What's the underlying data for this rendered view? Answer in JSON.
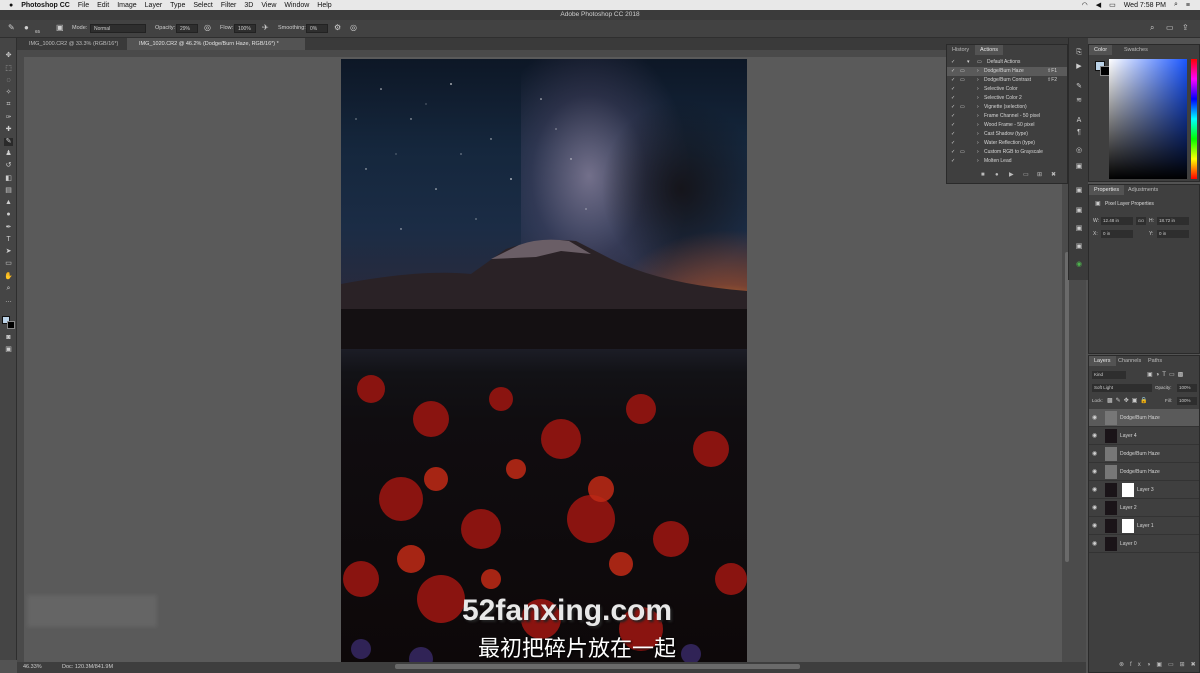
{
  "menubar": {
    "app": "Photoshop CC",
    "items": [
      "File",
      "Edit",
      "Image",
      "Layer",
      "Type",
      "Select",
      "Filter",
      "3D",
      "View",
      "Window",
      "Help"
    ],
    "clock": "Wed 7:58 PM"
  },
  "window_title": "Adobe Photoshop CC 2018",
  "options": {
    "brush_size": "65",
    "mode_label": "Mode:",
    "mode_value": "Normal",
    "opacity_label": "Opacity:",
    "opacity_value": "29%",
    "flow_label": "Flow:",
    "flow_value": "100%",
    "smoothing_label": "Smoothing:",
    "smoothing_value": "0%"
  },
  "tabs": [
    {
      "label": "IMG_1000.CR2 @ 33.3% (RGB/16*)"
    },
    {
      "label": "IMG_1020.CR2 @ 46.2% (Dodge/Burn Haze, RGB/16*) *"
    }
  ],
  "status": {
    "zoom": "46.33%",
    "doc": "Doc: 120.3M/841.9M"
  },
  "actions_panel": {
    "tabs": [
      "History",
      "Actions"
    ],
    "set_name": "Default Actions",
    "items": [
      {
        "name": "Dodge/Burn Haze",
        "key": "⇧F1"
      },
      {
        "name": "Dodge/Burn Contrast",
        "key": "⇧F2"
      },
      {
        "name": "Selective Color",
        "key": ""
      },
      {
        "name": "Selective Color 2",
        "key": ""
      },
      {
        "name": "Vignette (selection)",
        "key": ""
      },
      {
        "name": "Frame Channel - 50 pixel",
        "key": ""
      },
      {
        "name": "Wood Frame - 50 pixel",
        "key": ""
      },
      {
        "name": "Cast Shadow (type)",
        "key": ""
      },
      {
        "name": "Water Reflection (type)",
        "key": ""
      },
      {
        "name": "Custom RGB to Grayscale",
        "key": ""
      },
      {
        "name": "Molten Lead",
        "key": ""
      }
    ]
  },
  "color_panel": {
    "tabs": [
      "Color",
      "Swatches"
    ]
  },
  "properties_panel": {
    "tabs": [
      "Properties",
      "Adjustments"
    ],
    "heading": "Pixel Layer Properties",
    "w_label": "W:",
    "w_value": "12.48 in",
    "h_label": "H:",
    "h_value": "18.72 in",
    "link_label": "GO",
    "x_label": "X:",
    "x_value": "0 in",
    "y_label": "Y:",
    "y_value": "0 in"
  },
  "layers_panel": {
    "tabs": [
      "Layers",
      "Channels",
      "Paths"
    ],
    "kind": "Kind",
    "blend": "Soft Light",
    "opacity_label": "Opacity:",
    "opacity_value": "100%",
    "lock_label": "Lock:",
    "fill_label": "Fill:",
    "fill_value": "100%",
    "layers": [
      {
        "name": "Dodge/Burn Haze"
      },
      {
        "name": "Layer 4"
      },
      {
        "name": "Dodge/Burn Haze"
      },
      {
        "name": "Dodge/Burn Haze"
      },
      {
        "name": "Layer 3"
      },
      {
        "name": "Layer 2"
      },
      {
        "name": "Layer 1"
      },
      {
        "name": "Layer 0"
      }
    ]
  },
  "subtitle": {
    "watermark": "52fanxing.com",
    "caption": "最初把碎片放在一起"
  },
  "colors": {
    "accent": "#2d5a9a"
  }
}
